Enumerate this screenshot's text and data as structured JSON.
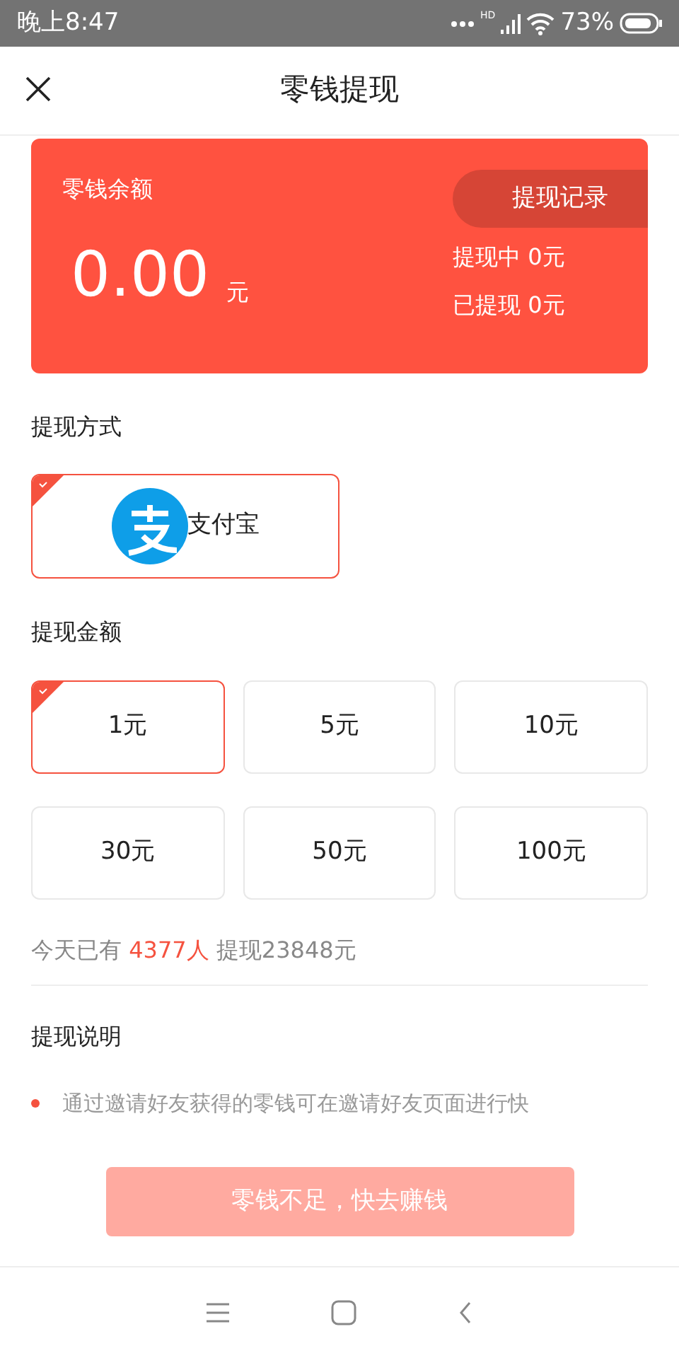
{
  "status_bar": {
    "time": "晚上8:47",
    "hd_label": "HD",
    "battery_text": "73%"
  },
  "header": {
    "title": "零钱提现"
  },
  "balance_card": {
    "label": "零钱余额",
    "amount": "0.00",
    "unit": "元",
    "history_button": "提现记录",
    "pending": "提现中 0元",
    "withdrawn": "已提现 0元"
  },
  "method_section": {
    "title": "提现方式",
    "methods": [
      {
        "label": "支付宝",
        "selected": true
      }
    ]
  },
  "amount_section": {
    "title": "提现金额",
    "options": [
      {
        "label": "1元",
        "selected": true
      },
      {
        "label": "5元",
        "selected": false
      },
      {
        "label": "10元",
        "selected": false
      },
      {
        "label": "30元",
        "selected": false
      },
      {
        "label": "50元",
        "selected": false
      },
      {
        "label": "100元",
        "selected": false
      }
    ]
  },
  "stats": {
    "prefix": "今天已有",
    "count": "4377人",
    "suffix": "提现23848元"
  },
  "notes": {
    "title": "提现说明",
    "items": [
      "通过邀请好友获得的零钱可在邀请好友页面进行快"
    ]
  },
  "action_button": {
    "label": "零钱不足，快去赚钱",
    "disabled": true
  }
}
